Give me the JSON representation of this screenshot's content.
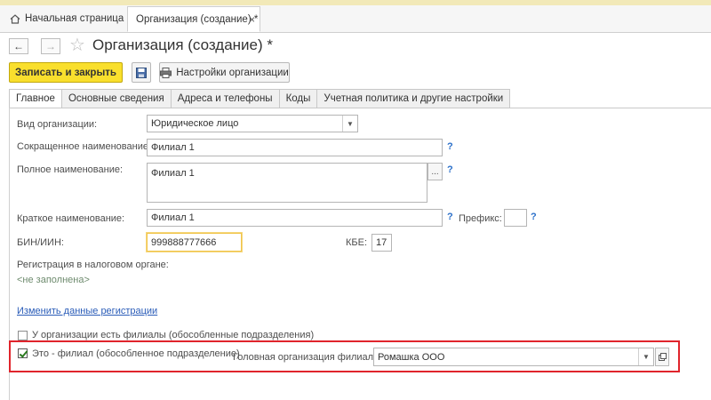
{
  "tabs": {
    "home_label": "Начальная страница",
    "document_label": "Организация (создание) *",
    "close_glyph": "×"
  },
  "nav": {
    "back_glyph": "←",
    "forward_glyph": "→",
    "star_glyph": "☆"
  },
  "header": {
    "title": "Организация (создание) *"
  },
  "toolbar": {
    "save_close_label": "Записать и закрыть",
    "settings_label": "Настройки организации"
  },
  "section_tabs": [
    {
      "label": "Главное",
      "active": true
    },
    {
      "label": "Основные сведения",
      "active": false
    },
    {
      "label": "Адреса и телефоны",
      "active": false
    },
    {
      "label": "Коды",
      "active": false
    },
    {
      "label": "Учетная политика и другие настройки",
      "active": false
    }
  ],
  "form": {
    "org_type": {
      "label": "Вид организации:",
      "value": "Юридическое лицо"
    },
    "short_name": {
      "label": "Сокращенное наименование:",
      "value": "Филиал 1"
    },
    "full_name": {
      "label": "Полное наименование:",
      "value": "Филиал 1"
    },
    "brief_name": {
      "label": "Краткое наименование:",
      "value": "Филиал 1"
    },
    "prefix": {
      "label": "Префикс:",
      "value": ""
    },
    "bin": {
      "label": "БИН/ИИН:",
      "value": "999888777666"
    },
    "kbe": {
      "label": "КБЕ:",
      "value": "17"
    },
    "tax_registration": {
      "label": "Регистрация в налоговом органе:",
      "value": "<не заполнена>"
    },
    "change_registration_link": "Изменить данные регистрации",
    "has_branches": {
      "label": "У организации есть филиалы (обособленные подразделения)",
      "checked": false
    },
    "is_branch": {
      "label": "Это - филиал (обособленное подразделение)",
      "checked": true
    },
    "head_org": {
      "label": "Головная организация филиала:",
      "value": "Ромашка ООО"
    },
    "help_glyph": "?",
    "ellipsis_glyph": "...",
    "dropdown_glyph": "▼"
  },
  "colors": {
    "highlight_border": "#e0242c",
    "primary_button": "#f9df2d"
  }
}
